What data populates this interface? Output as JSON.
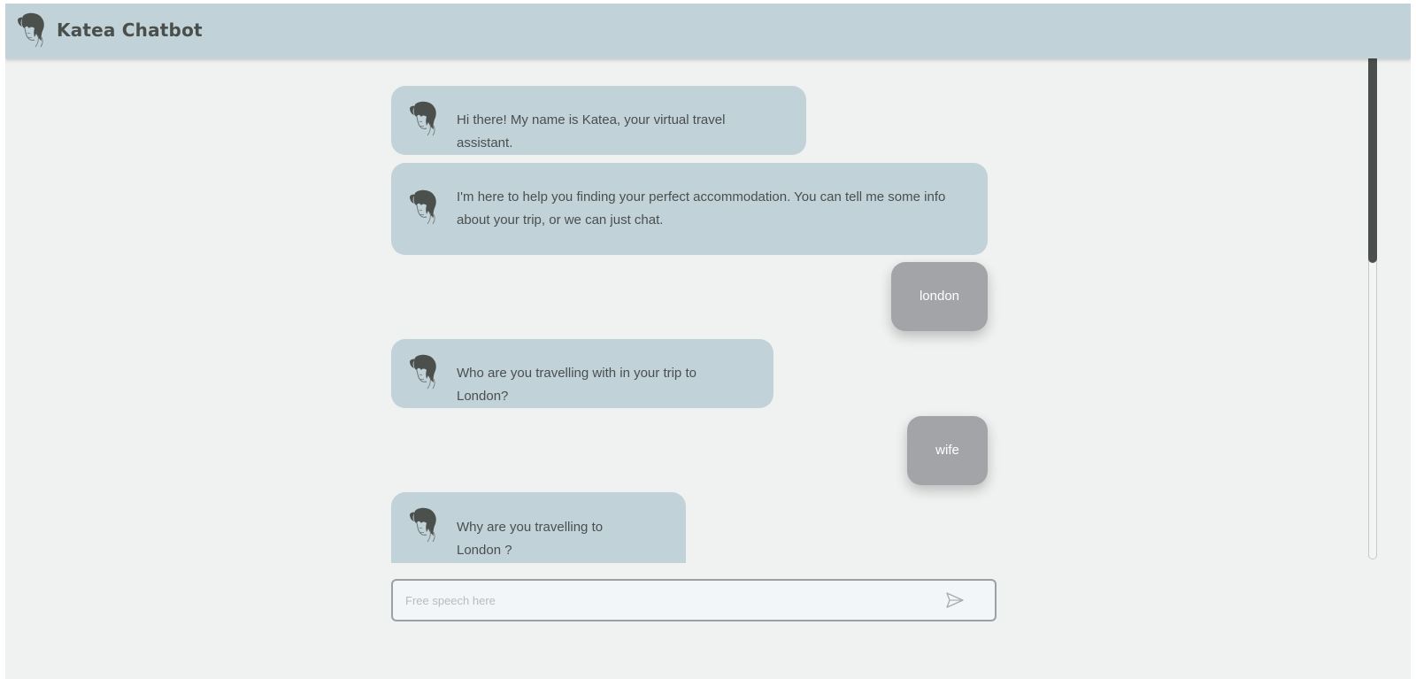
{
  "header": {
    "title": "Katea Chatbot",
    "logo_icon": "woman-profile-icon"
  },
  "messages": [
    {
      "sender": "bot",
      "text": "Hi there! My name is Katea, your virtual travel assistant."
    },
    {
      "sender": "bot",
      "text": "I'm here to help you finding your perfect accommodation. You can tell me some info about your trip, or we can just chat."
    },
    {
      "sender": "user",
      "text": "london"
    },
    {
      "sender": "bot",
      "text": "Who are you travelling with in your trip to London?"
    },
    {
      "sender": "user",
      "text": "wife"
    },
    {
      "sender": "bot",
      "text": "Why are you travelling to London ?"
    }
  ],
  "composer": {
    "placeholder": "Free speech here",
    "value": "",
    "send_icon": "send-arrow-icon"
  },
  "colors": {
    "header_bg": "#c1d2d9",
    "bot_bubble": "#c1d2d9",
    "user_bubble": "#a3a4a7",
    "page_bg": "#f0f2f1",
    "title_text": "#4b4f4c"
  }
}
